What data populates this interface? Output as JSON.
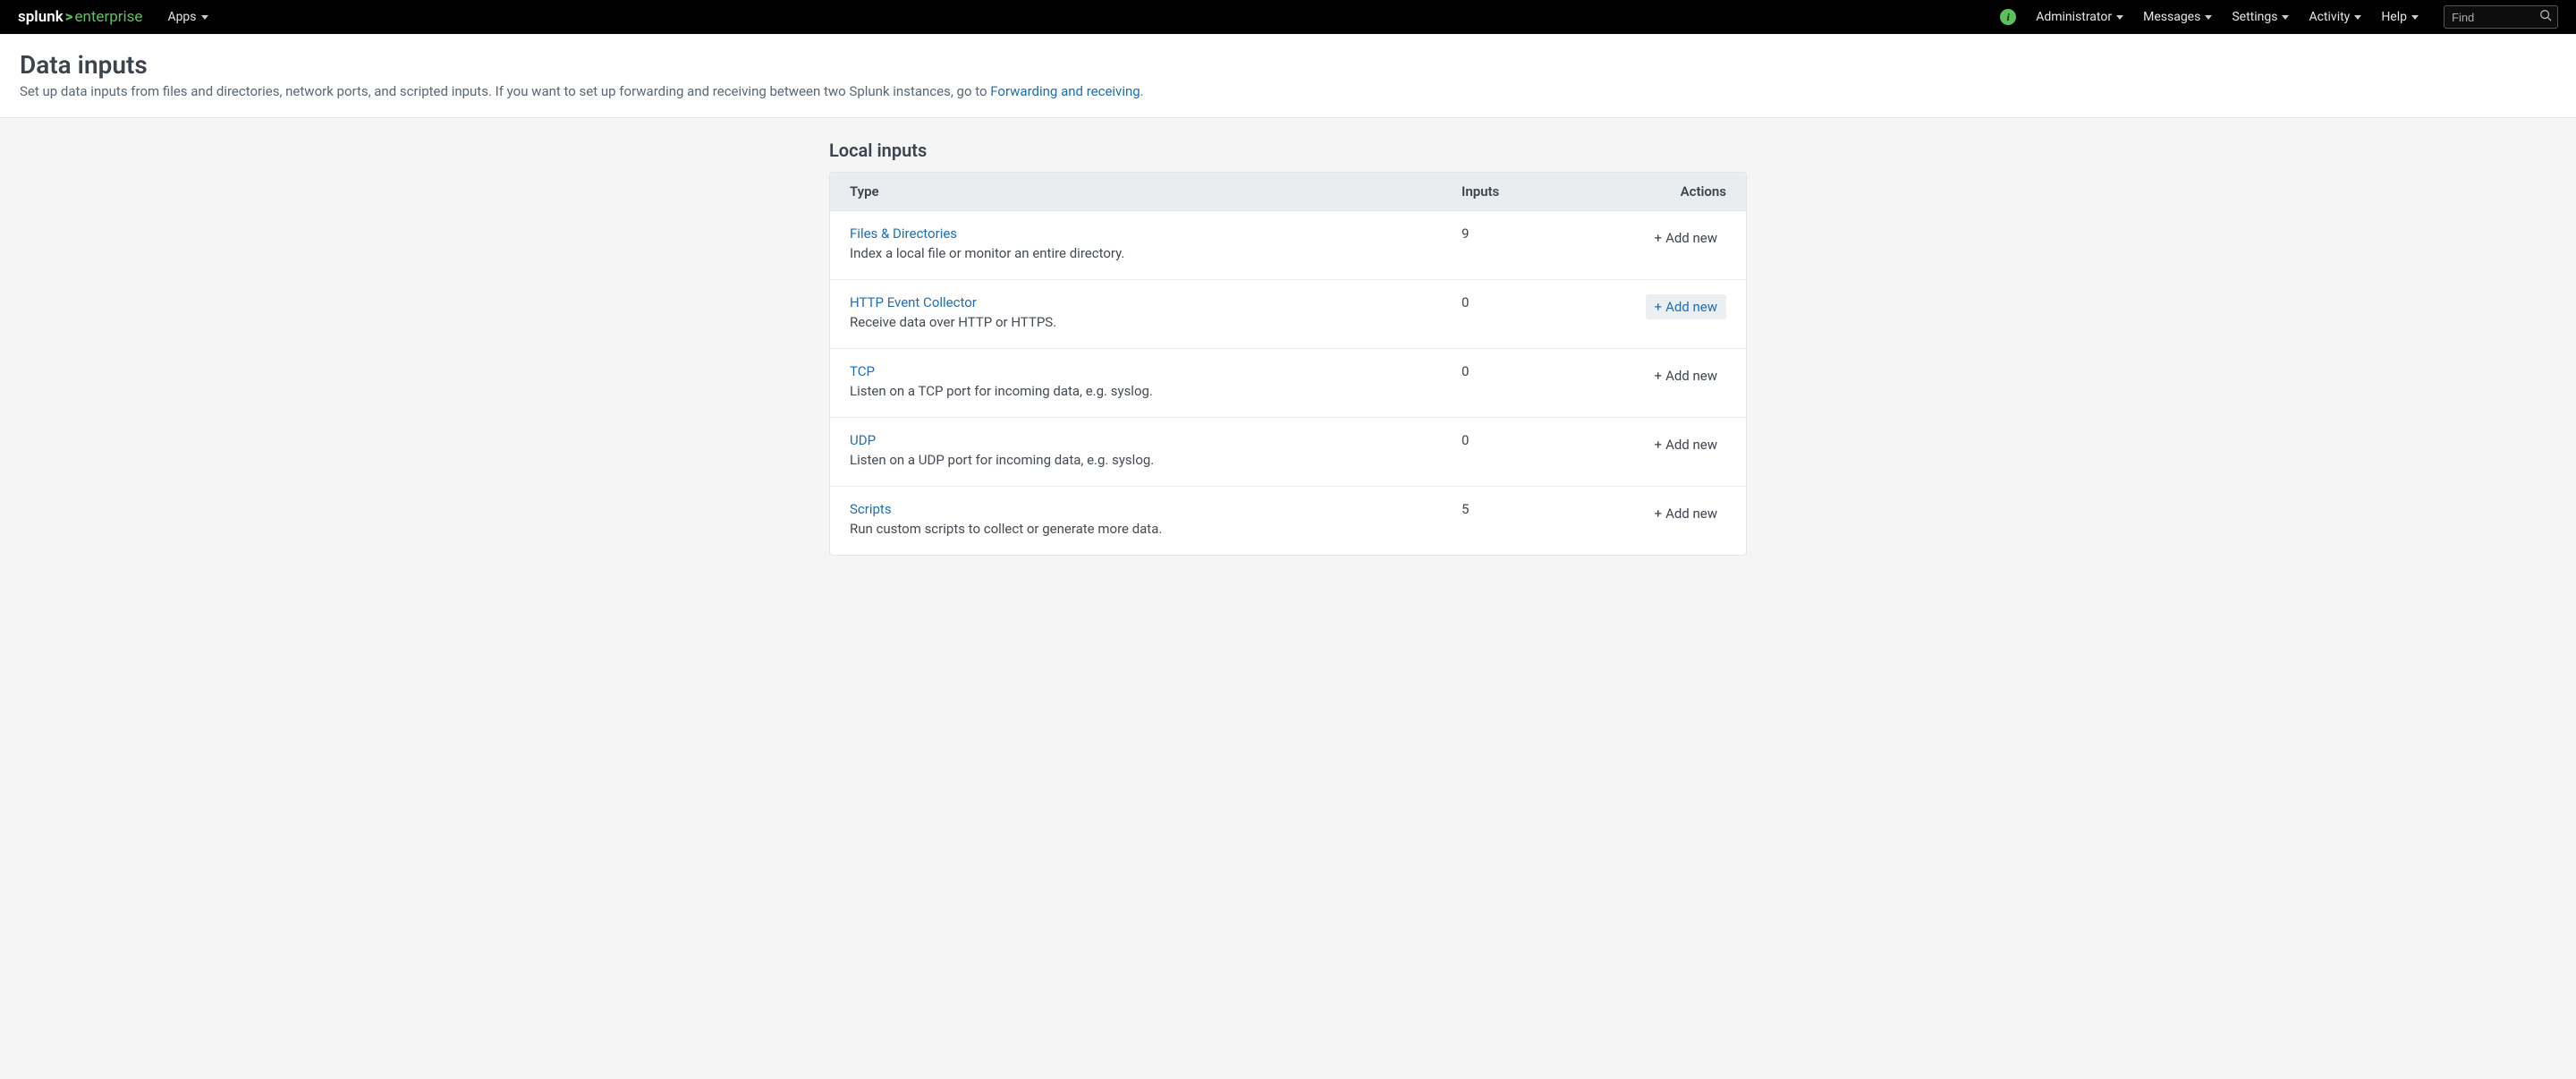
{
  "brand": {
    "name": "splunk",
    "product": "enterprise"
  },
  "nav": {
    "apps": "Apps",
    "administrator": "Administrator",
    "messages": "Messages",
    "settings": "Settings",
    "activity": "Activity",
    "help": "Help",
    "find_placeholder": "Find"
  },
  "header": {
    "title": "Data inputs",
    "subtitle_before": "Set up data inputs from files and directories, network ports, and scripted inputs. If you want to set up forwarding and receiving between two Splunk instances, go to ",
    "subtitle_link": "Forwarding and receiving",
    "subtitle_after": "."
  },
  "section_title": "Local inputs",
  "table": {
    "cols": {
      "type": "Type",
      "inputs": "Inputs",
      "actions": "Actions"
    },
    "add_label": "Add new",
    "rows": [
      {
        "name": "Files & Directories",
        "desc": "Index a local file or monitor an entire directory.",
        "count": "9",
        "hovered": false
      },
      {
        "name": "HTTP Event Collector",
        "desc": "Receive data over HTTP or HTTPS.",
        "count": "0",
        "hovered": true
      },
      {
        "name": "TCP",
        "desc": "Listen on a TCP port for incoming data, e.g. syslog.",
        "count": "0",
        "hovered": false
      },
      {
        "name": "UDP",
        "desc": "Listen on a UDP port for incoming data, e.g. syslog.",
        "count": "0",
        "hovered": false
      },
      {
        "name": "Scripts",
        "desc": "Run custom scripts to collect or generate more data.",
        "count": "5",
        "hovered": false
      }
    ]
  }
}
